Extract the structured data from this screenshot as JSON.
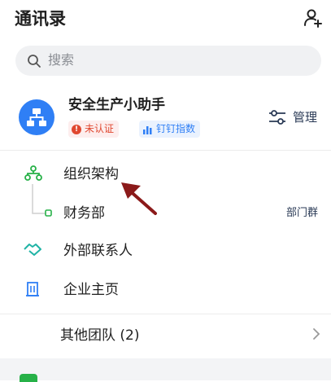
{
  "header": {
    "title": "通讯录"
  },
  "search": {
    "placeholder": "搜索"
  },
  "org": {
    "name": "安全生产小助手",
    "badge_unverified": "未认证",
    "badge_index": "钉钉指数",
    "manage_label": "管理"
  },
  "menu": {
    "org_structure": "组织架构",
    "finance_dept": "财务部",
    "dept_group_tag": "部门群",
    "external_contacts": "外部联系人",
    "company_page": "企业主页",
    "other_teams": "其他团队 (2)"
  },
  "colors": {
    "accent_blue": "#2f7ff5",
    "green": "#27b148",
    "teal": "#1fb3a5",
    "annotation_arrow": "#8b1a1a"
  }
}
